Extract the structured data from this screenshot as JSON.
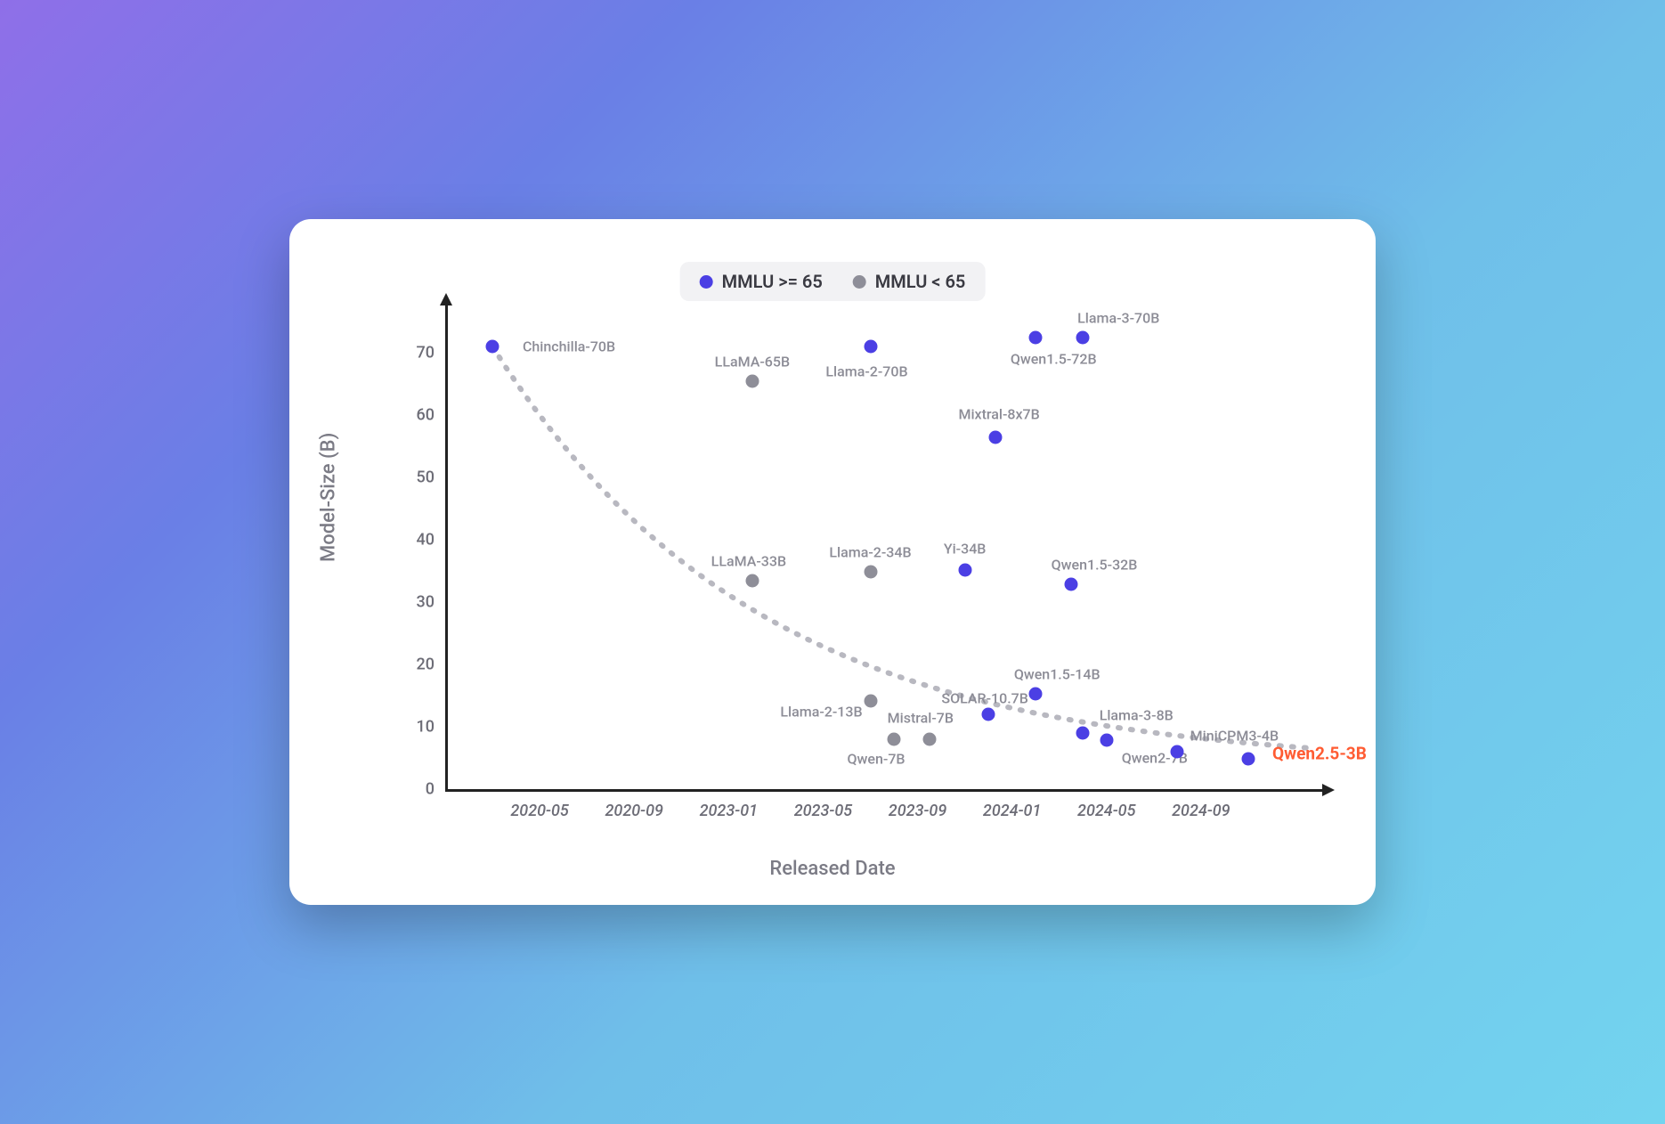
{
  "chart_data": {
    "type": "scatter",
    "xlabel": "Released Date",
    "ylabel": "Model-Size  (B)",
    "ylim": [
      0,
      75
    ],
    "y_ticks": [
      0,
      10,
      20,
      30,
      40,
      50,
      60,
      70
    ],
    "x_ticks": [
      "2020-05",
      "2020-09",
      "2023-01",
      "2023-05",
      "2023-09",
      "2024-01",
      "2024-05",
      "2024-09"
    ],
    "legend": [
      {
        "label": "MMLU >= 65",
        "color": "#4b3fe4"
      },
      {
        "label": "MMLU < 65",
        "color": "#8e8e98"
      }
    ],
    "colors": {
      "high": "#4b3fe4",
      "low": "#8e8e98",
      "highlight": "#ff5c33"
    },
    "series": [
      {
        "name": "Chinchilla-70B",
        "x": "2020-03",
        "y": 71,
        "group": "high",
        "label_dx": 86,
        "label_dy": 0
      },
      {
        "name": "LLaMA-65B",
        "x": "2023-02",
        "y": 65.5,
        "group": "low",
        "label_dx": 0,
        "label_dy": -22
      },
      {
        "name": "LLaMA-33B",
        "x": "2023-02",
        "y": 33.5,
        "group": "low",
        "label_dx": -4,
        "label_dy": -22
      },
      {
        "name": "Llama-2-70B",
        "x": "2023-07",
        "y": 71,
        "group": "high",
        "label_dx": -4,
        "label_dy": 28
      },
      {
        "name": "Llama-2-34B",
        "x": "2023-07",
        "y": 34.8,
        "group": "low",
        "label_dx": 0,
        "label_dy": -22
      },
      {
        "name": "Llama-2-13B",
        "x": "2023-07",
        "y": 14.2,
        "group": "low",
        "label_dx": -55,
        "label_dy": 12
      },
      {
        "name": "Qwen-7B",
        "x": "2023-08",
        "y": 8,
        "group": "low",
        "label_dx": -20,
        "label_dy": 22
      },
      {
        "name": "Mistral-7B",
        "x": "2023-09.5",
        "y": 8,
        "group": "low",
        "label_dx": -10,
        "label_dy": -24
      },
      {
        "name": "Yi-34B",
        "x": "2023-11",
        "y": 35.2,
        "group": "high",
        "label_dx": 0,
        "label_dy": -24
      },
      {
        "name": "SOLAR-10.7B",
        "x": "2023-12",
        "y": 12,
        "group": "high",
        "label_dx": -4,
        "label_dy": -18
      },
      {
        "name": "Mixtral-8x7B",
        "x": "2023-12.3",
        "y": 56.5,
        "group": "high",
        "label_dx": 4,
        "label_dy": -26
      },
      {
        "name": "Qwen1.5-72B",
        "x": "2024-02",
        "y": 72.5,
        "group": "high",
        "label_dx": 20,
        "label_dy": 24
      },
      {
        "name": "Qwen1.5-32B",
        "x": "2024-03.5",
        "y": 32.8,
        "group": "high",
        "label_dx": 26,
        "label_dy": -22
      },
      {
        "name": "Qwen1.5-14B",
        "x": "2024-02",
        "y": 15.3,
        "group": "high",
        "label_dx": 24,
        "label_dy": -22
      },
      {
        "name": "Llama-3-70B",
        "x": "2024-04",
        "y": 72.5,
        "group": "high",
        "label_dx": 40,
        "label_dy": -22
      },
      {
        "name": "Llama-3-8B",
        "x": "2024-04",
        "y": 9,
        "group": "high",
        "label_dx": 60,
        "label_dy": -20
      },
      {
        "name": "Qwen2-7B",
        "x": "2024-05",
        "y": 7.8,
        "group": "high",
        "label_dx": 54,
        "label_dy": 20
      },
      {
        "name": "MiniCPM3-4B",
        "x": "2024-08",
        "y": 6,
        "group": "high",
        "label_dx": 64,
        "label_dy": -18
      },
      {
        "name": "Qwen2.5-3B",
        "x": "2024-11",
        "y": 4.8,
        "group": "high",
        "label_dx": 80,
        "label_dy": -6,
        "highlight": true
      }
    ],
    "trendline": "decreasing"
  }
}
